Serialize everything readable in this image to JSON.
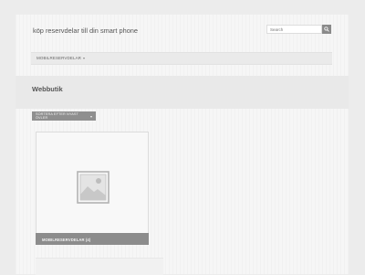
{
  "header": {
    "site_title": "köp reservdelar till din smart phone",
    "search_placeholder": "Search"
  },
  "nav": {
    "items": [
      {
        "label": "MOBILRESERVDELAR",
        "has_dropdown": true
      }
    ]
  },
  "page": {
    "title": "Webbutik"
  },
  "sort": {
    "label": "SORTERA EFTER NYAST ÖVLER"
  },
  "products": [
    {
      "caption": "MOBILRESERVDELAR (4)",
      "icon": "image-placeholder-icon"
    }
  ],
  "colors": {
    "background": "#ececec",
    "panel": "#f6f6f6",
    "accent_gray": "#8c8c8c"
  }
}
